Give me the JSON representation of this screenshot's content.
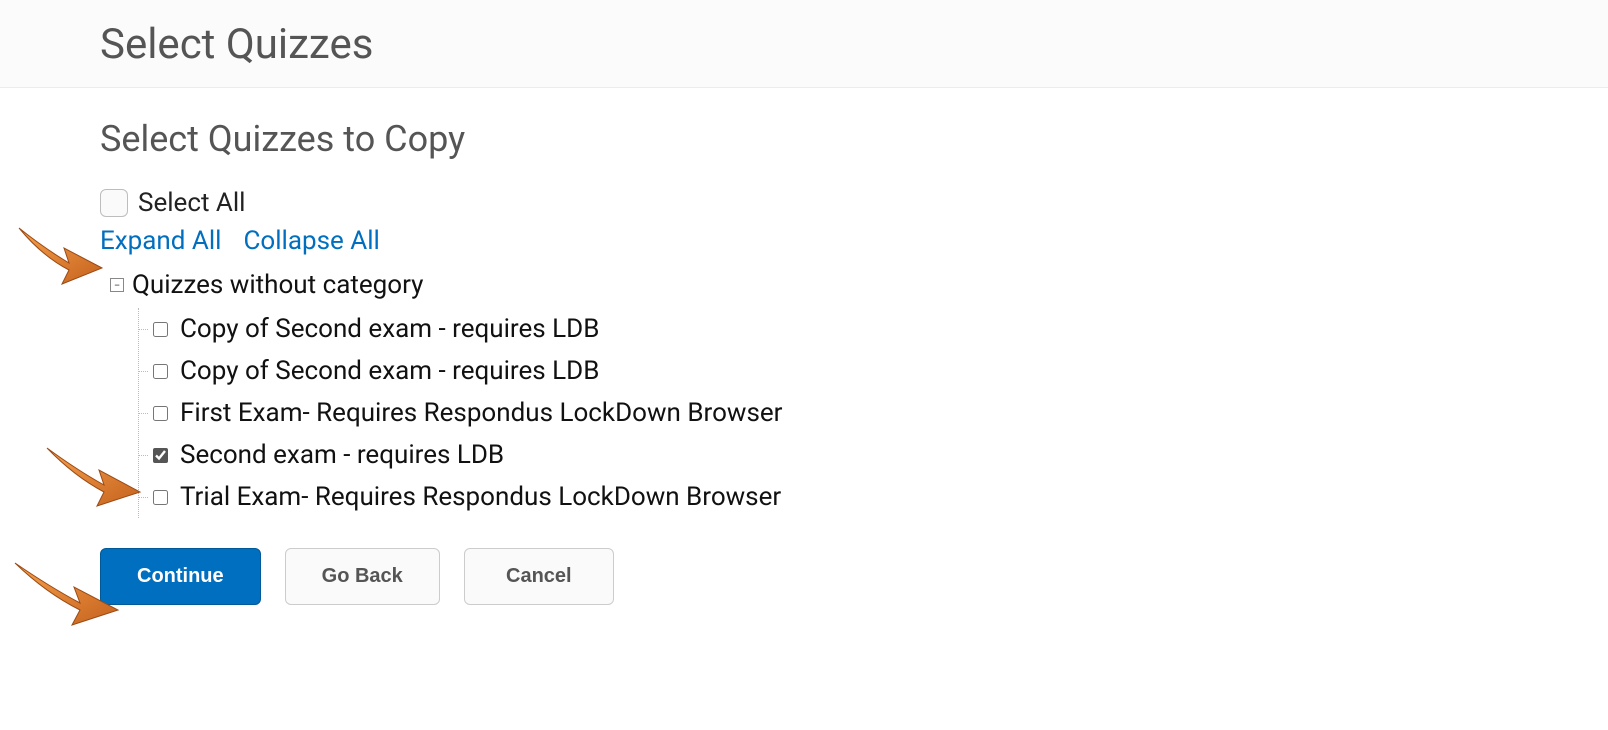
{
  "page_title": "Select Quizzes",
  "subtitle": "Select Quizzes to Copy",
  "select_all_label": "Select All",
  "expand_all_label": "Expand All",
  "collapse_all_label": "Collapse All",
  "category_label": "Quizzes without category",
  "quizzes": [
    {
      "label": "Copy of Second exam - requires LDB",
      "checked": false
    },
    {
      "label": "Copy of Second exam - requires LDB",
      "checked": false
    },
    {
      "label": "First Exam- Requires Respondus LockDown Browser",
      "checked": false
    },
    {
      "label": "Second exam - requires LDB",
      "checked": true
    },
    {
      "label": "Trial Exam- Requires Respondus LockDown Browser",
      "checked": false
    }
  ],
  "buttons": {
    "continue": "Continue",
    "go_back": "Go Back",
    "cancel": "Cancel"
  }
}
